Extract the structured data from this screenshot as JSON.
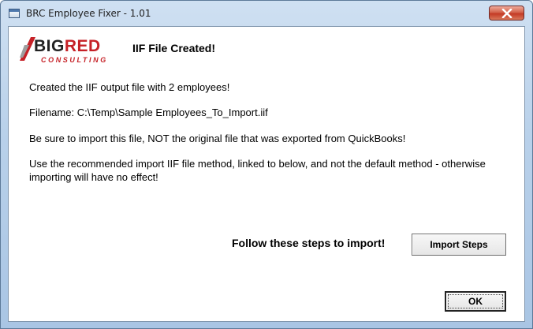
{
  "window": {
    "title": "BRC Employee Fixer - 1.01"
  },
  "logo": {
    "brand_black": "BIG",
    "brand_red": "RED",
    "subtitle": "CONSULTING"
  },
  "dialog": {
    "heading": "IIF File Created!",
    "messages": [
      "Created the IIF output file with 2 employees!",
      "Filename: C:\\Temp\\Sample Employees_To_Import.iif",
      "Be sure to import this file, NOT the original file that was exported from QuickBooks!",
      "Use the recommended import IIF file method, linked to below, and not the default method - otherwise importing will have no effect!"
    ],
    "follow_text": "Follow these steps to import!",
    "import_steps_label": "Import Steps",
    "ok_label": "OK"
  },
  "colors": {
    "brand_red": "#c62127",
    "close_red": "#c43a25"
  }
}
